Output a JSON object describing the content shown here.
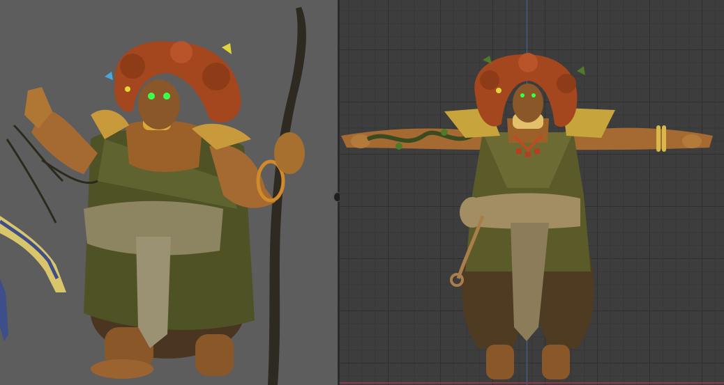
{
  "colors": {
    "reference_background": "#5d5d5e",
    "viewport_background": "#3d3d3d",
    "viewport_grid": "#2f2f2f",
    "axis_vertical": "#3e6aa8",
    "axis_horizontal": "#8a3b4a",
    "skin": "#a46a32",
    "hair": "#a4461e",
    "robe_green": "#5b5b2a",
    "pants": "#4f3a22",
    "eyes": "#3cff4c"
  },
  "icons": {
    "splitter": "drag-handle-icon"
  }
}
